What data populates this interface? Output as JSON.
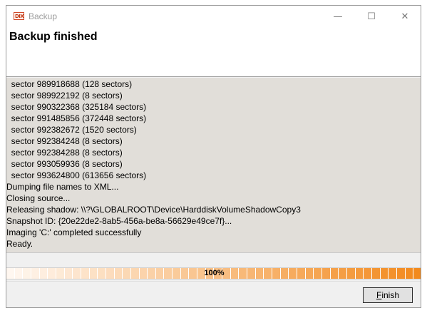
{
  "window": {
    "title": "Backup",
    "icon": "app-icon",
    "controls": {
      "minimize": "minimize-icon",
      "maximize": "maximize-icon",
      "close": "close-icon"
    }
  },
  "header": {
    "title": "Backup finished"
  },
  "log": {
    "lines": [
      "  sector 989918688 (128 sectors)",
      "  sector 989922192 (8 sectors)",
      "  sector 990322368 (325184 sectors)",
      "  sector 991485856 (372448 sectors)",
      "  sector 992382672 (1520 sectors)",
      "  sector 992384248 (8 sectors)",
      "  sector 992384288 (8 sectors)",
      "  sector 993059936 (8 sectors)",
      "  sector 993624800 (613656 sectors)",
      "Dumping file names to XML...",
      "Closing source...",
      "Releasing shadow: \\\\?\\GLOBALROOT\\Device\\HarddiskVolumeShadowCopy3",
      "Snapshot ID: {20e22de2-8ab5-456a-be8a-56629e49ce7f}...",
      "Imaging 'C:' completed successfully",
      "Ready."
    ]
  },
  "progress": {
    "label": "100%",
    "value": 1.0,
    "color_start": "#fff7f0",
    "color_end": "#f28a1e"
  },
  "buttons": {
    "finish_first": "F",
    "finish_rest": "inish"
  }
}
